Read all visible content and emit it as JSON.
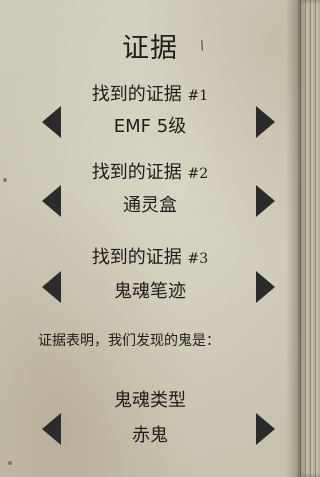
{
  "title": "证据",
  "evidence": [
    {
      "label": "找到的证据",
      "number": "#1",
      "value": "EMF 5级"
    },
    {
      "label": "找到的证据",
      "number": "#2",
      "value": "通灵盒"
    },
    {
      "label": "找到的证据",
      "number": "#3",
      "value": "鬼魂笔迹"
    }
  ],
  "statement": "证据表明，我们发现的鬼是：",
  "ghost": {
    "label": "鬼魂类型",
    "value": "赤鬼"
  }
}
